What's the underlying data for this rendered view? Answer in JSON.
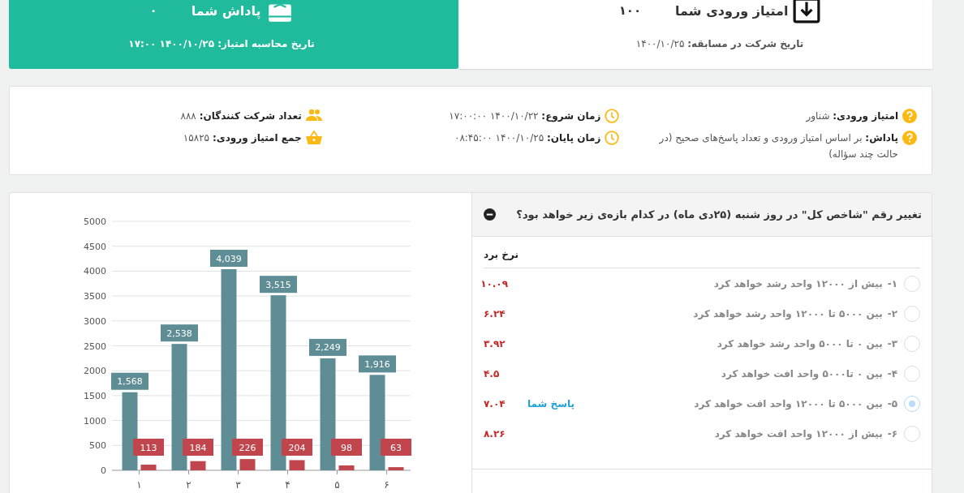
{
  "score_card": {
    "title": "امتیاز ورودی شما",
    "value": "۱۰۰",
    "date": "**تاریخ شرکت در مسابقه:** ۱۴۰۰/۱۰/۲۵"
  },
  "reward_card": {
    "title": "پاداش شما",
    "value": "۰",
    "date": "**تاریخ محاسبه امتیاز:** ۱۴۰۰/۱۰/۲۵ ۱۷:۰۰"
  },
  "info": {
    "columns": [
      [
        {
          "kind": "question",
          "text": "**امتیاز ورودی:** شناور"
        },
        {
          "kind": "question",
          "text": "**پاداش:** بر اساس امتیاز ورودی و تعداد پاسخ‌های صحیح (در حالت چند سؤاله)"
        }
      ],
      [
        {
          "kind": "clock",
          "text": "**زمان شروع:** ۱۴۰۰/۱۰/۲۲ ۱۷:۰۰:۰۰"
        },
        {
          "kind": "clock",
          "text": "**زمان پایان:** ۱۴۰۰/۱۰/۲۵ ۰۸:۴۵:۰۰"
        }
      ],
      [
        {
          "kind": "people",
          "text": "**تعداد شرکت کنندگان:** ۸۸۸"
        },
        {
          "kind": "basket",
          "text": "**جمع امتیاز ورودی:** ۱۵۸۲۵"
        }
      ]
    ]
  },
  "question": {
    "title": "تغییر رقم \"شاخص کل\" در روز شنبه (۲۵دی ماه) در کدام بازه‌ی زیر خواهد بود؟",
    "expanded": true,
    "rate_header": "نرخ برد",
    "your_answer_label": "پاسخ شما",
    "options": [
      {
        "number": "۱-",
        "text": "بیش از ۱۲۰۰۰ واحد رشد خواهد کرد",
        "rate": "۱۰.۰۹",
        "selected": false
      },
      {
        "number": "۲-",
        "text": "بین ۵۰۰۰ تا ۱۲۰۰۰ واحد رشد خواهد کرد",
        "rate": "۶.۲۴",
        "selected": false
      },
      {
        "number": "۳-",
        "text": "بین ۰ تا ۵۰۰۰ واحد رشد خواهد کرد",
        "rate": "۳.۹۲",
        "selected": false
      },
      {
        "number": "۴-",
        "text": "بین ۰ تا۵۰۰۰ واحد افت خواهد کرد",
        "rate": "۴.۵",
        "selected": false
      },
      {
        "number": "۵-",
        "text": "بین ۵۰۰۰ تا ۱۲۰۰۰ واحد افت خواهد کرد",
        "rate": "۷.۰۴",
        "selected": true
      },
      {
        "number": "۶-",
        "text": "بیش از ۱۲۰۰۰ واحد افت خواهد کرد",
        "rate": "۸.۲۶",
        "selected": false
      }
    ]
  },
  "chart_data": {
    "type": "bar",
    "categories": [
      "۱",
      "۲",
      "۳",
      "۴",
      "۵",
      "۶"
    ],
    "series": [
      {
        "color": "#5e8d96",
        "values": [
          1568,
          2538,
          4039,
          3515,
          2249,
          1916
        ]
      },
      {
        "color": "#c0454c",
        "values": [
          113,
          184,
          226,
          204,
          98,
          63
        ]
      }
    ],
    "ylim": [
      0,
      5000
    ],
    "yticks": [
      0,
      500,
      1000,
      1500,
      2000,
      2500,
      3000,
      3500,
      4000,
      4500,
      5000
    ],
    "grid": true,
    "value_labels": [
      [
        "1,568",
        "2,538",
        "4,039",
        "3,515",
        "2,249",
        "1,916"
      ],
      [
        "113",
        "184",
        "226",
        "204",
        "98",
        "63"
      ]
    ]
  }
}
